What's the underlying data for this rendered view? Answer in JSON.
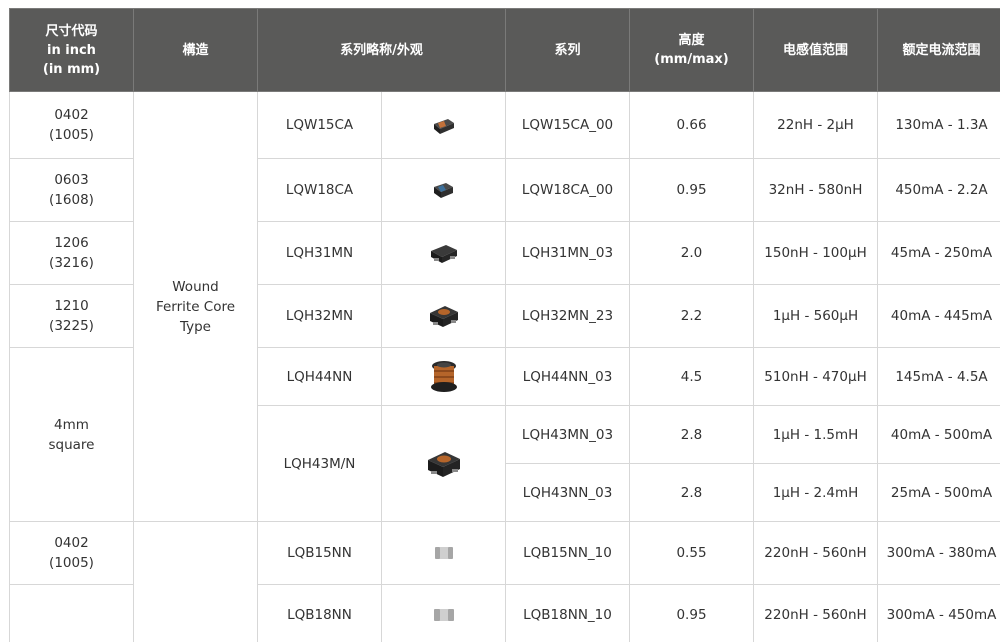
{
  "headers": {
    "size_code": [
      "尺寸代码",
      "in inch",
      "(in mm)"
    ],
    "structure": "構造",
    "series_short_name": "系列略称/外观",
    "series": "系列",
    "height": [
      "高度",
      "(mm/max)"
    ],
    "inductance_range": "电感值范围",
    "rated_current_range": "额定电流范围"
  },
  "size_codes": [
    [
      "0402",
      "(1005)"
    ],
    [
      "0603",
      "(1608)"
    ],
    [
      "1206",
      "(3216)"
    ],
    [
      "1210",
      "(3225)"
    ],
    [
      "4mm",
      "square"
    ],
    [
      "0402",
      "(1005)"
    ]
  ],
  "structure_groups": [
    [
      "Wound",
      "Ferrite Core",
      "Type"
    ]
  ],
  "short_names": [
    "LQW15CA",
    "LQW18CA",
    "LQH31MN",
    "LQH32MN",
    "LQH44NN",
    "LQH43M/N",
    "LQB15NN",
    "LQB18NN"
  ],
  "component_icons": [
    "wound-chip-small-icon",
    "wound-chip-small-icon",
    "wound-smd-inductor-icon",
    "wound-smd-inductor-icon",
    "drum-core-inductor-icon",
    "wound-smd-inductor-icon",
    "multilayer-chip-icon",
    "multilayer-chip-icon"
  ],
  "rows": [
    {
      "series": "LQW15CA_00",
      "height": "0.66",
      "inductance": "22nH - 2µH",
      "current": "130mA - 1.3A"
    },
    {
      "series": "LQW18CA_00",
      "height": "0.95",
      "inductance": "32nH - 580nH",
      "current": "450mA - 2.2A"
    },
    {
      "series": "LQH31MN_03",
      "height": "2.0",
      "inductance": "150nH - 100µH",
      "current": "45mA - 250mA"
    },
    {
      "series": "LQH32MN_23",
      "height": "2.2",
      "inductance": "1µH - 560µH",
      "current": "40mA - 445mA"
    },
    {
      "series": "LQH44NN_03",
      "height": "4.5",
      "inductance": "510nH - 470µH",
      "current": "145mA - 4.5A"
    },
    {
      "series": "LQH43MN_03",
      "height": "2.8",
      "inductance": "1µH - 1.5mH",
      "current": "40mA - 500mA"
    },
    {
      "series": "LQH43NN_03",
      "height": "2.8",
      "inductance": "1µH - 2.4mH",
      "current": "25mA - 500mA"
    },
    {
      "series": "LQB15NN_10",
      "height": "0.55",
      "inductance": "220nH - 560nH",
      "current": "300mA - 380mA"
    },
    {
      "series": "LQB18NN_10",
      "height": "0.95",
      "inductance": "220nH - 560nH",
      "current": "300mA - 450mA"
    }
  ],
  "colors": {
    "header_bg": "#5a5a59",
    "header_text": "#ffffff",
    "border": "#d7d7d7",
    "ferrite_body": "#2b2b2b",
    "copper_winding": "#b5652a",
    "ceramic_gray": "#9a9a9a"
  }
}
